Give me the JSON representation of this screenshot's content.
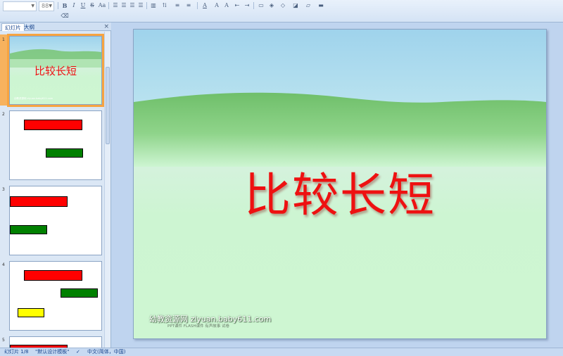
{
  "toolbar": {
    "font_name": "",
    "font_size": "88",
    "buttons": [
      "bold-icon",
      "italic-icon",
      "underline-icon",
      "strikethrough-icon",
      "font-case-icon",
      "align-left-icon",
      "align-center-icon",
      "align-right-icon",
      "justify-icon",
      "columns-icon",
      "text-direction-icon",
      "bullets-icon",
      "numbering-icon",
      "decrease-indent-icon",
      "increase-indent-icon",
      "font-color-icon",
      "grow-font-icon",
      "shrink-font-icon",
      "clear-format-icon",
      "shapes-icon",
      "arrange-icon",
      "quick-styles-icon",
      "shape-fill-icon",
      "shape-outline-icon",
      "shape-effects-icon"
    ]
  },
  "left_panel": {
    "tab_slides": "幻灯片",
    "tab_outline": "大纲",
    "close": "×"
  },
  "thumbnails": [
    {
      "num": "1",
      "title": "比较长短",
      "caption": "幼教资源网 ziyuan.baby611.com"
    },
    {
      "num": "2"
    },
    {
      "num": "3"
    },
    {
      "num": "4"
    },
    {
      "num": "5"
    }
  ],
  "slide": {
    "title": "比较长短",
    "footer": "幼教资源网 ziyuan.baby611.com",
    "footer_sub": "PPT课件    FLASH课件    有声故事    试卷"
  },
  "colors": {
    "title_red": "#ee1111",
    "bar_red": "#ff0000",
    "bar_green": "#008000",
    "bar_yellow": "#ffff00",
    "selection": "#f7a441"
  },
  "statusbar": {
    "slide_info": "幻灯片 1/8",
    "theme": "\"默认设计模板\"",
    "language": "中文(简体，中国)"
  }
}
